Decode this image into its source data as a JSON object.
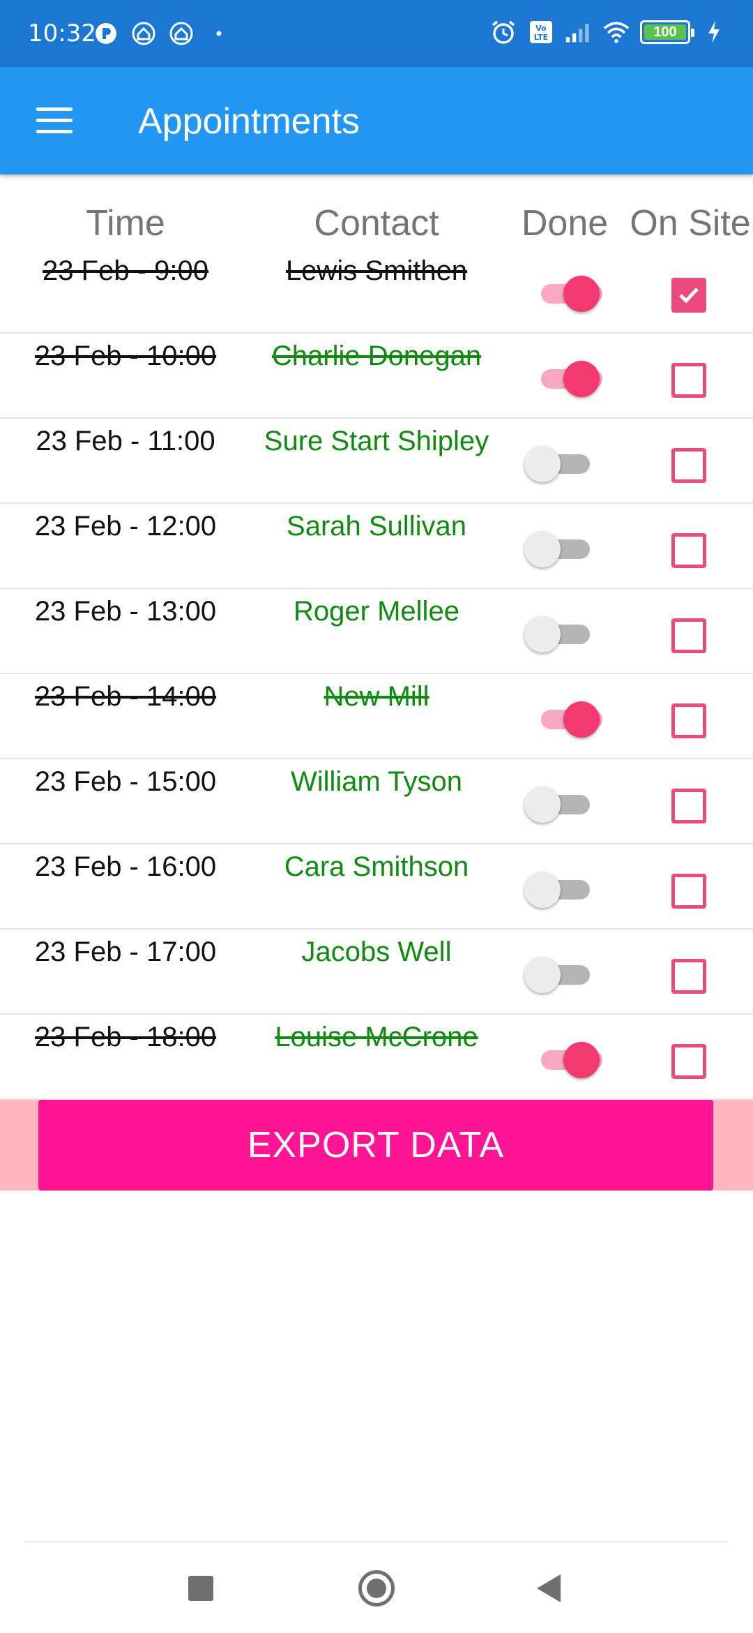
{
  "status_bar": {
    "time": "10:32",
    "battery_level": "100",
    "icons_left": [
      "p-app-icon",
      "home-app-icon",
      "home-app-icon",
      "dot-icon"
    ],
    "icons_right": [
      "alarm-icon",
      "volte-icon",
      "signal-icon",
      "wifi-icon",
      "battery-icon",
      "charging-icon"
    ]
  },
  "app_bar": {
    "title": "Appointments",
    "menu_icon": "hamburger-menu-icon",
    "color": "#2196f3"
  },
  "table": {
    "headers": {
      "time": "Time",
      "contact": "Contact",
      "done": "Done",
      "on_site": "On Site"
    },
    "rows": [
      {
        "time": "23 Feb - 9:00",
        "contact": "Lewis Smithen",
        "done": true,
        "on_site": true
      },
      {
        "time": "23 Feb - 10:00",
        "contact": "Charlie Donegan",
        "done": true,
        "on_site": false
      },
      {
        "time": "23 Feb - 11:00",
        "contact": "Sure Start Shipley",
        "done": false,
        "on_site": false
      },
      {
        "time": "23 Feb - 12:00",
        "contact": "Sarah Sullivan",
        "done": false,
        "on_site": false
      },
      {
        "time": "23 Feb - 13:00",
        "contact": "Roger Mellee",
        "done": false,
        "on_site": false
      },
      {
        "time": "23 Feb - 14:00",
        "contact": "New Mill",
        "done": true,
        "on_site": false
      },
      {
        "time": "23 Feb - 15:00",
        "contact": "William Tyson",
        "done": false,
        "on_site": false
      },
      {
        "time": "23 Feb - 16:00",
        "contact": "Cara Smithson",
        "done": false,
        "on_site": false
      },
      {
        "time": "23 Feb - 17:00",
        "contact": "Jacobs Well",
        "done": false,
        "on_site": false
      },
      {
        "time": "23 Feb - 18:00",
        "contact": "Louise McCrone",
        "done": true,
        "on_site": false
      }
    ]
  },
  "export": {
    "label": "EXPORT DATA",
    "color": "#ff1493"
  },
  "colors": {
    "contact_text": "#118a11",
    "accent": "#f23a70",
    "checkbox": "#ea4b7c"
  },
  "nav_bar": {
    "icons": [
      "recent-apps-icon",
      "home-icon",
      "back-icon"
    ]
  }
}
